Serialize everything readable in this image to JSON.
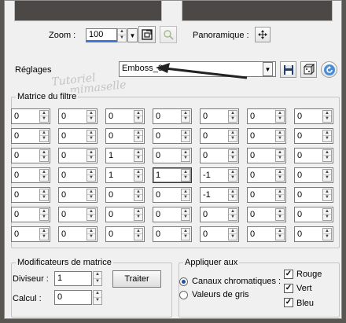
{
  "zoom": {
    "label": "Zoom :",
    "value": "100"
  },
  "panoramique": {
    "label": "Panoramique :"
  },
  "reglages": {
    "label": "Réglages",
    "value": "Emboss_3"
  },
  "watermark": {
    "line1": "Tutoriel",
    "line2": "mimaselle"
  },
  "matrix": {
    "title": "Matrice du filtre",
    "rows": [
      [
        "0",
        "0",
        "0",
        "0",
        "0",
        "0",
        "0"
      ],
      [
        "0",
        "0",
        "0",
        "0",
        "0",
        "0",
        "0"
      ],
      [
        "0",
        "0",
        "1",
        "0",
        "0",
        "0",
        "0"
      ],
      [
        "0",
        "0",
        "1",
        "1",
        "-1",
        "0",
        "0"
      ],
      [
        "0",
        "0",
        "0",
        "0",
        "-1",
        "0",
        "0"
      ],
      [
        "0",
        "0",
        "0",
        "0",
        "0",
        "0",
        "0"
      ],
      [
        "0",
        "0",
        "0",
        "0",
        "0",
        "0",
        "0"
      ]
    ]
  },
  "modificateurs": {
    "title": "Modificateurs de matrice",
    "diviseur_label": "Diviseur :",
    "diviseur_value": "1",
    "calcul_label": "Calcul :",
    "calcul_value": "0",
    "traiter_label": "Traiter"
  },
  "appliquer": {
    "title": "Appliquer aux",
    "canaux_label": "Canaux chromatiques :",
    "valeurs_label": "Valeurs de gris",
    "rouge_label": "Rouge",
    "vert_label": "Vert",
    "bleu_label": "Bleu"
  }
}
